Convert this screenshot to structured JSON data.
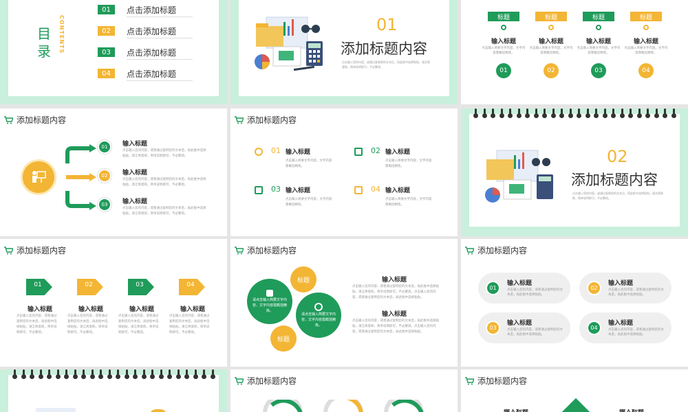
{
  "colors": {
    "green": "#1f9b5a",
    "gold": "#f3b534",
    "mint": "#c9f0dc",
    "grey": "#9a9a9a",
    "dark": "#333333"
  },
  "icons": [
    "cart-icon",
    "presentation-icon",
    "target-icon",
    "monitor-icon",
    "people-icon",
    "runner-icon",
    "gear-icon",
    "refresh-icon"
  ],
  "slide1": {
    "title_chars": [
      "目",
      "录"
    ],
    "contents_label": "CONTENTS",
    "items": [
      {
        "num": "01",
        "label": "点击添加标题"
      },
      {
        "num": "02",
        "label": "点击添加标题"
      },
      {
        "num": "03",
        "label": "点击添加标题"
      },
      {
        "num": "04",
        "label": "点击添加标题"
      }
    ]
  },
  "slide2": {
    "num": "01",
    "title": "添加标题内容",
    "desc": "点击输入您的内容，或通过复制您的文本后，再此框中选择粘贴，请言简意赅，简单说明即可，不必繁琐。"
  },
  "slide3": {
    "tags": [
      "标题",
      "标题",
      "标题",
      "标题"
    ],
    "titles": [
      "输入标题",
      "输入标题",
      "输入标题",
      "输入标题"
    ],
    "desc": "点击输入简要文字内容，文字内容需概括精炼。",
    "nums": [
      "01",
      "02",
      "03",
      "04"
    ]
  },
  "header_title": "添加标题内容",
  "slide4": {
    "items": [
      {
        "num": "01",
        "title": "输入标题",
        "desc": "点击输入您的内容，或者通过复制您的文本后，再此框中选择粘贴，请言简意赅，简单说明即可，不必繁琐。"
      },
      {
        "num": "02",
        "title": "输入标题",
        "desc": "点击输入您的内容，或者通过复制您的文本后，再此框中选择粘贴，请言简意赅，简单说明即可，不必繁琐。"
      },
      {
        "num": "03",
        "title": "输入标题",
        "desc": "点击输入您的内容，或者通过复制您的文本后，再此框中选择粘贴，请言简意赅，简单说明即可，不必繁琐。"
      }
    ]
  },
  "slide5": {
    "items": [
      {
        "num": "01",
        "title": "输入标题",
        "desc": "点击输入简要文字内容，文字内容需概括精炼。"
      },
      {
        "num": "02",
        "title": "输入标题",
        "desc": "点击输入简要文字内容，文字内容需概括精炼。"
      },
      {
        "num": "03",
        "title": "输入标题",
        "desc": "点击输入简要文字内容，文字内容需概括精炼。"
      },
      {
        "num": "04",
        "title": "输入标题",
        "desc": "点击输入简要文字内容，文字内容需概括精炼。"
      }
    ]
  },
  "slide6": {
    "num": "02",
    "title": "添加标题内容",
    "desc": "点击输入您的内容，或通过复制您的文本后，再此框中选择粘贴，请言简意赅，简单说明即可，不必繁琐。"
  },
  "slide7": {
    "items": [
      {
        "num": "01",
        "title": "输入标题",
        "desc": "点击输入您的内容，或者通过复制您的文本后，再此框中选择粘贴，请言简意赅，简单说明即可，不必繁琐。"
      },
      {
        "num": "02",
        "title": "输入标题",
        "desc": "点击输入您的内容，或者通过复制您的文本后，再此框中选择粘贴，请言简意赅，简单说明即可，不必繁琐。"
      },
      {
        "num": "03",
        "title": "输入标题",
        "desc": "点击输入您的内容，或者通过复制您的文本后，再此框中选择粘贴，请言简意赅，简单说明即可，不必繁琐。"
      },
      {
        "num": "04",
        "title": "输入标题",
        "desc": "点击输入您的内容，或者通过复制您的文本后，再此框中选择粘贴，请言简意赅，简单说明即可，不必繁琐。"
      }
    ]
  },
  "slide8": {
    "bubble_label": "标题",
    "bubble_text": "请点击输入简要文字内容，文字内容需概括精炼。",
    "blocks": [
      {
        "title": "输入标题",
        "desc": "点击输入您的内容，或者通过复制您的文本后，再此框中选择粘贴，请言简意赅，简单说明即可，不必繁琐。点击输入您的内容，或者通过复制您的文本后，再此框中选择粘贴。"
      },
      {
        "title": "输入标题",
        "desc": "点击输入您的内容，或者通过复制您的文本后，再此框中选择粘贴，请言简意赅，简单说明即可，不必繁琐。点击输入您的内容，或者通过复制您的文本后，再此框中选择粘贴。"
      }
    ]
  },
  "slide9": {
    "items": [
      {
        "num": "01",
        "title": "输入标题",
        "desc": "点击输入您的内容，或者通过复制您的文本后，再此框中选择粘贴。"
      },
      {
        "num": "02",
        "title": "输入标题",
        "desc": "点击输入您的内容，或者通过复制您的文本后，再此框中选择粘贴。"
      },
      {
        "num": "03",
        "title": "输入标题",
        "desc": "点击输入您的内容，或者通过复制您的文本后，再此框中选择粘贴。"
      },
      {
        "num": "04",
        "title": "输入标题",
        "desc": "点击输入您的内容，或者通过复制您的文本后，再此框中选择粘贴。"
      }
    ]
  },
  "slide12": {
    "partial_titles": [
      "输入标题",
      "输入标题"
    ]
  }
}
